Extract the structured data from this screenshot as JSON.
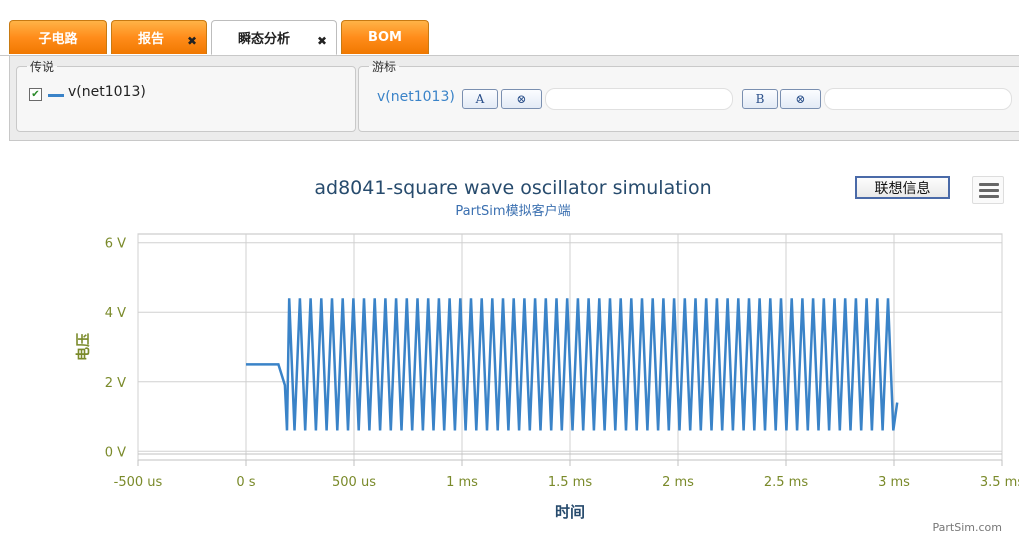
{
  "tabs": [
    {
      "label": "子电路",
      "closable": false,
      "active": false
    },
    {
      "label": "报告",
      "closable": true,
      "active": false
    },
    {
      "label": "瞬态分析",
      "closable": true,
      "active": true
    },
    {
      "label": "BOM",
      "closable": false,
      "active": false
    }
  ],
  "close_glyph": "✖",
  "legend_panel": {
    "title": "传说",
    "series_checked": true,
    "series_label": "v(net1013)",
    "series_color": "#3a83c8"
  },
  "cursor_panel": {
    "title": "游标",
    "series_name": "v(net1013)",
    "cursor_a": "A",
    "cursor_b": "B",
    "clear_glyph": "⊗"
  },
  "toolbar": {
    "info_button": "联想信息",
    "menu_icon": "hamburger-menu-icon"
  },
  "credit": "PartSim.com",
  "colors": {
    "tab_orange": "#ff8c1a",
    "series": "#3a83c8",
    "axis_label": "#7a8a2a",
    "title": "#274b6d"
  },
  "chart_data": {
    "type": "line",
    "title": "ad8041-square wave oscillator simulation",
    "subtitle": "PartSim模拟客户端",
    "xlabel": "时间",
    "ylabel": "电压",
    "x_ticks": [
      "-500 us",
      "0 s",
      "500 us",
      "1 ms",
      "1.5 ms",
      "2 ms",
      "2.5 ms",
      "3 ms",
      "3.5 ms"
    ],
    "y_ticks": [
      "0 V",
      "2 V",
      "4 V",
      "6 V"
    ],
    "xlim": [
      -0.0005,
      0.0035
    ],
    "ylim": [
      -0.25,
      6.25
    ],
    "grid": true,
    "series": [
      {
        "name": "v(net1013)",
        "initial_level": 2.5,
        "initial_until": 0.00015,
        "oscillation_start": 0.0002,
        "oscillation_end": 0.003,
        "period": 4.95e-05,
        "high": 4.4,
        "low": 0.6,
        "final_value": 1.4
      }
    ]
  }
}
